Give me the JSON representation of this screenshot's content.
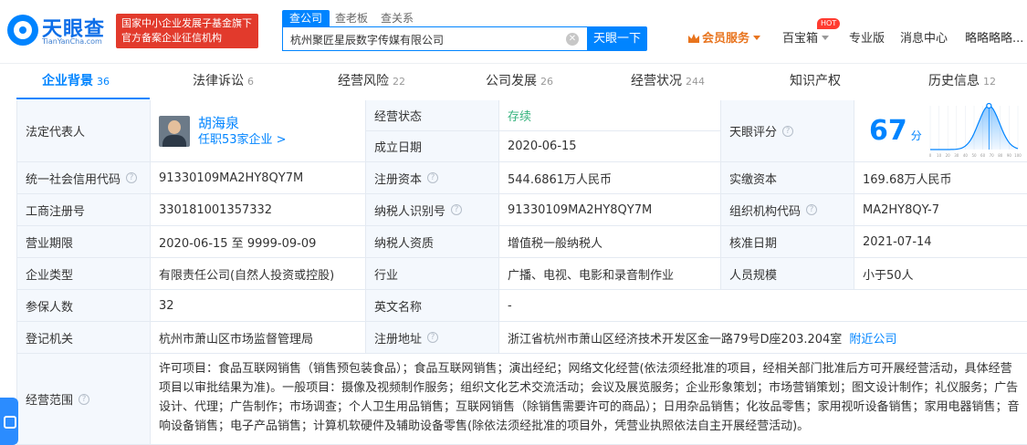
{
  "header": {
    "logo_title": "天眼查",
    "logo_sub": "TianYanCha.com",
    "gov_badge_line1": "国家中小企业发展子基金旗下",
    "gov_badge_line2": "官方备案企业征信机构",
    "search_tabs": [
      "查公司",
      "查老板",
      "查关系"
    ],
    "search_value": "杭州聚匠星辰数字传媒有限公司",
    "search_button": "天眼一下",
    "nav": {
      "vip": "会员服务",
      "treasure": "百宝箱",
      "hot": "HOT",
      "pro": "专业版",
      "messages": "消息中心",
      "user": "略略略略..."
    }
  },
  "tabs": [
    {
      "label": "企业背景",
      "count": "36"
    },
    {
      "label": "法律诉讼",
      "count": "6"
    },
    {
      "label": "经营风险",
      "count": "22"
    },
    {
      "label": "公司发展",
      "count": "26"
    },
    {
      "label": "经营状况",
      "count": "244"
    },
    {
      "label": "知识产权",
      "count": ""
    },
    {
      "label": "历史信息",
      "count": "12"
    }
  ],
  "info": {
    "legal_rep_label": "法定代表人",
    "legal_rep_name": "胡海泉",
    "legal_rep_sub": "任职53家企业 >",
    "status_label": "经营状态",
    "status_value": "存续",
    "founded_label": "成立日期",
    "founded_value": "2020-06-15",
    "score_label": "天眼评分",
    "score_value": "67",
    "score_unit": "分",
    "credit_code_label": "统一社会信用代码",
    "credit_code_value": "91330109MA2HY8QY7M",
    "reg_capital_label": "注册资本",
    "reg_capital_value": "544.6861万人民币",
    "paid_capital_label": "实缴资本",
    "paid_capital_value": "169.68万人民币",
    "biz_reg_no_label": "工商注册号",
    "biz_reg_no_value": "330181001357332",
    "taxpayer_id_label": "纳税人识别号",
    "taxpayer_id_value": "91330109MA2HY8QY7M",
    "org_code_label": "组织机构代码",
    "org_code_value": "MA2HY8QY-7",
    "term_label": "营业期限",
    "term_value": "2020-06-15 至 9999-09-09",
    "taxpayer_type_label": "纳税人资质",
    "taxpayer_type_value": "增值税一般纳税人",
    "approval_date_label": "核准日期",
    "approval_date_value": "2021-07-14",
    "company_type_label": "企业类型",
    "company_type_value": "有限责任公司(自然人投资或控股)",
    "industry_label": "行业",
    "industry_value": "广播、电视、电影和录音制作业",
    "staff_size_label": "人员规模",
    "staff_size_value": "小于50人",
    "insured_label": "参保人数",
    "insured_value": "32",
    "english_name_label": "英文名称",
    "english_name_value": "-",
    "reg_authority_label": "登记机关",
    "reg_authority_value": "杭州市萧山区市场监督管理局",
    "address_label": "注册地址",
    "address_value": "浙江省杭州市萧山区经济技术开发区金一路79号D座203.204室",
    "address_link": "附近公司",
    "scope_label": "经营范围",
    "scope_value": "许可项目：食品互联网销售（销售预包装食品）；食品互联网销售；演出经纪；网络文化经营(依法须经批准的项目，经相关部门批准后方可开展经营活动，具体经营项目以审批结果为准)。一般项目：摄像及视频制作服务；组织文化艺术交流活动；会议及展览服务；企业形象策划；市场营销策划；图文设计制作；礼仪服务；广告设计、代理；广告制作；市场调查；个人卫生用品销售；互联网销售（除销售需要许可的商品）；日用杂品销售；化妆品零售；家用视听设备销售；家用电器销售；音响设备销售；电子产品销售；计算机软硬件及辅助设备零售(除依法须经批准的项目外，凭营业执照依法自主开展经营活动)。"
  },
  "score_chart": {
    "x_ticks": [
      "0",
      "10",
      "20",
      "30",
      "40",
      "50",
      "60",
      "70",
      "80",
      "90",
      "100"
    ],
    "marker_value": 67,
    "color": "#0084ff"
  },
  "colors": {
    "accent": "#0084ff",
    "status_green": "#36b37e",
    "badge_red": "#e23a2c",
    "vip_orange": "#e8741e",
    "label_bg": "#f4f8fd"
  }
}
